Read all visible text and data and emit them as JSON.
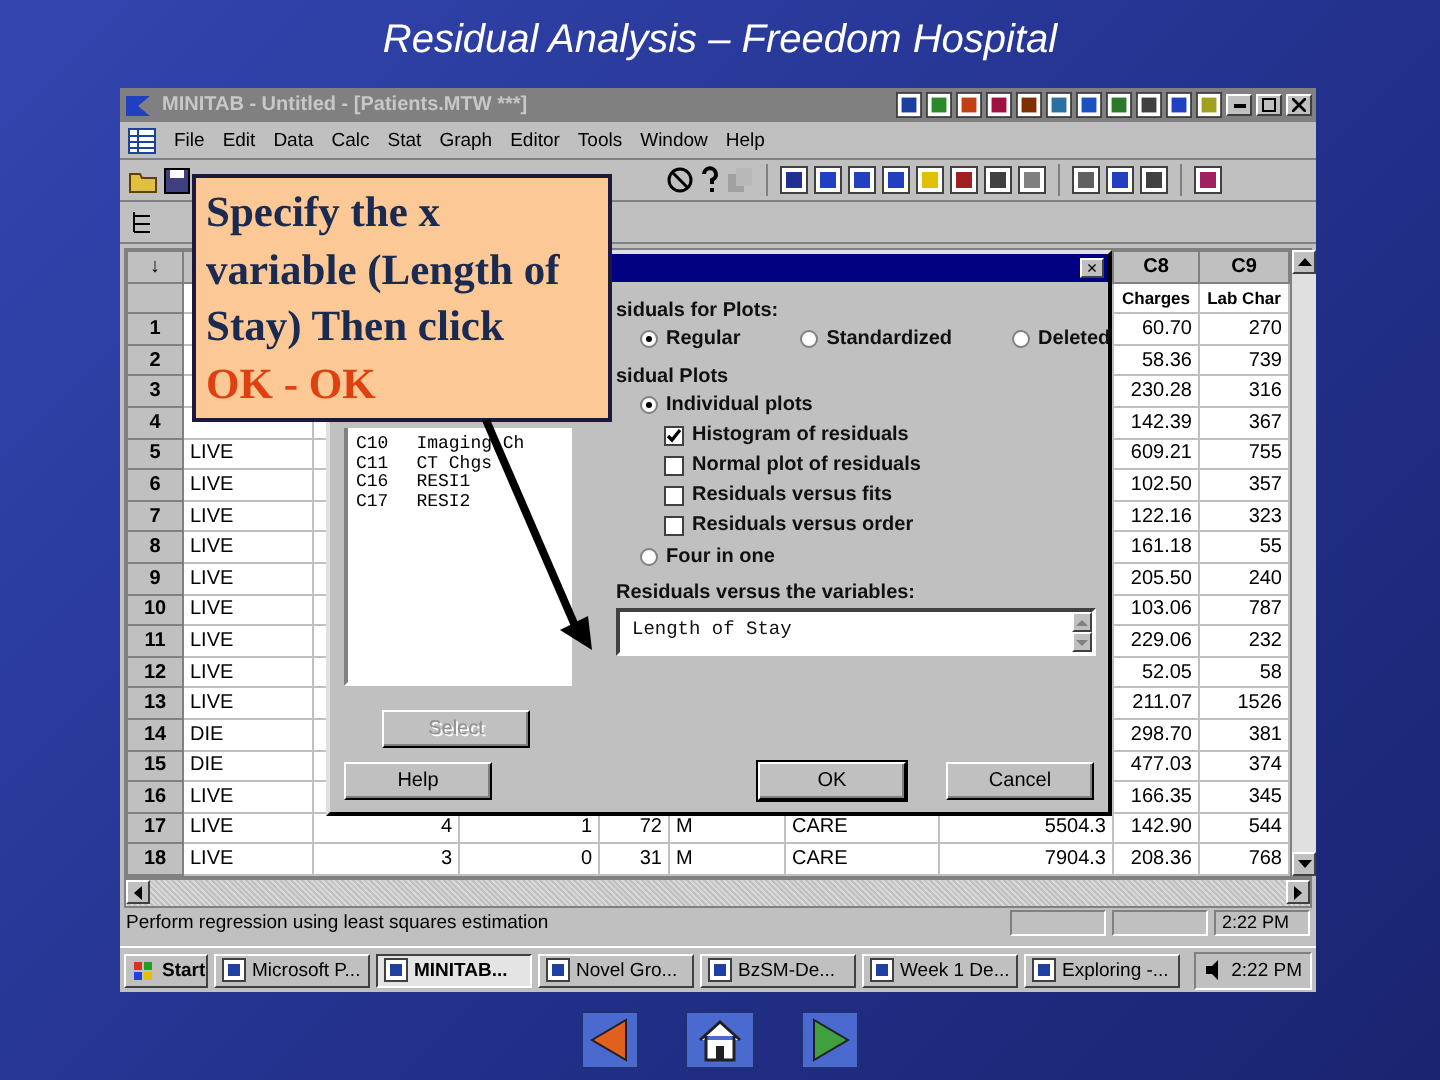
{
  "slide_title": "Residual Analysis – Freedom Hospital",
  "window": {
    "title": "MINITAB - Untitled - [Patients.MTW ***]"
  },
  "menu": [
    "File",
    "Edit",
    "Data",
    "Calc",
    "Stat",
    "Graph",
    "Editor",
    "Tools",
    "Window",
    "Help"
  ],
  "worksheet": {
    "corner": "↓",
    "columns": [
      {
        "id": "C8",
        "name": "Charges"
      },
      {
        "id": "C9",
        "name": "Lab Char"
      }
    ],
    "rows": [
      {
        "number": "1",
        "c8": "60.70",
        "c9": "270"
      },
      {
        "number": "2",
        "c8": "58.36",
        "c9": "739"
      },
      {
        "number": "3",
        "c8": "230.28",
        "c9": "316"
      },
      {
        "number": "4",
        "c8": "142.39",
        "c9": "367"
      },
      {
        "number": "5",
        "c1": "LIVE",
        "c8": "609.21",
        "c9": "755"
      },
      {
        "number": "6",
        "c1": "LIVE",
        "c8": "102.50",
        "c9": "357"
      },
      {
        "number": "7",
        "c1": "LIVE",
        "c8": "122.16",
        "c9": "323"
      },
      {
        "number": "8",
        "c1": "LIVE",
        "c8": "161.18",
        "c9": "55"
      },
      {
        "number": "9",
        "c1": "LIVE",
        "c8": "205.50",
        "c9": "240"
      },
      {
        "number": "10",
        "c1": "LIVE",
        "c8": "103.06",
        "c9": "787"
      },
      {
        "number": "11",
        "c1": "LIVE",
        "c8": "229.06",
        "c9": "232"
      },
      {
        "number": "12",
        "c1": "LIVE",
        "c8": "52.05",
        "c9": "58"
      },
      {
        "number": "13",
        "c1": "LIVE",
        "c8": "211.07",
        "c9": "1526"
      },
      {
        "number": "14",
        "c1": "DIE",
        "c8": "298.70",
        "c9": "381"
      },
      {
        "number": "15",
        "c1": "DIE",
        "c8": "477.03",
        "c9": "374"
      },
      {
        "number": "16",
        "c1": "LIVE",
        "c8": "166.35",
        "c9": "345"
      },
      {
        "number": "17",
        "c1": "LIVE",
        "middle": [
          "4",
          "1",
          "72",
          "M",
          "CARE",
          "5504.3"
        ],
        "c8": "142.90",
        "c9": "544"
      },
      {
        "number": "18",
        "c1": "LIVE",
        "middle": [
          "3",
          "0",
          "31",
          "M",
          "CARE",
          "7904.3"
        ],
        "c8": "208.36",
        "c9": "768"
      }
    ]
  },
  "status_bar": {
    "message": "Perform regression using least squares estimation",
    "time": "2:22 PM"
  },
  "taskbar": {
    "items": [
      {
        "label": "Start",
        "kind": "start",
        "selected": false
      },
      {
        "label": "Microsoft P...",
        "kind": "app",
        "selected": false
      },
      {
        "label": "MINITAB...",
        "kind": "app",
        "selected": true
      },
      {
        "label": "Novel Gro...",
        "kind": "app",
        "selected": false
      },
      {
        "label": "BzSM-De...",
        "kind": "app",
        "selected": false
      },
      {
        "label": "Week 1 De...",
        "kind": "app",
        "selected": false
      },
      {
        "label": "Exploring -...",
        "kind": "app",
        "selected": false
      }
    ],
    "time": "2:22 PM"
  },
  "dialog": {
    "close": "×",
    "variables_list": [
      {
        "column": "C10",
        "name": "Imaging Ch"
      },
      {
        "column": "C11",
        "name": "CT Chgs"
      },
      {
        "column": "C16",
        "name": "RESI1"
      },
      {
        "column": "C17",
        "name": "RESI2"
      }
    ],
    "residuals_for_plots": {
      "label": "siduals for Plots:",
      "options": [
        {
          "label": "Regular",
          "selected": true
        },
        {
          "label": "Standardized",
          "selected": false
        },
        {
          "label": "Deleted",
          "selected": false
        }
      ]
    },
    "residual_plots": {
      "label": "sidual Plots",
      "options": [
        {
          "label": "Individual plots",
          "selected": true,
          "children": [
            {
              "label": "Histogram of residuals",
              "checked": true
            },
            {
              "label": "Normal plot of residuals",
              "checked": false
            },
            {
              "label": "Residuals versus fits",
              "checked": false
            },
            {
              "label": "Residuals versus order",
              "checked": false
            }
          ]
        },
        {
          "label": "Four in one",
          "selected": false
        }
      ]
    },
    "variables": {
      "label": "Residuals versus the variables:",
      "value": "Length of Stay"
    },
    "buttons": [
      {
        "label": "Select",
        "kind": "select",
        "disabled": true
      },
      {
        "label": "Help",
        "kind": "help",
        "disabled": false
      },
      {
        "label": "OK",
        "kind": "ok",
        "disabled": false
      },
      {
        "label": "Cancel",
        "kind": "cancel",
        "disabled": false
      }
    ]
  },
  "callout": {
    "text": "Specify the x variable (Length of Stay) Then click",
    "action": "OK - OK"
  }
}
